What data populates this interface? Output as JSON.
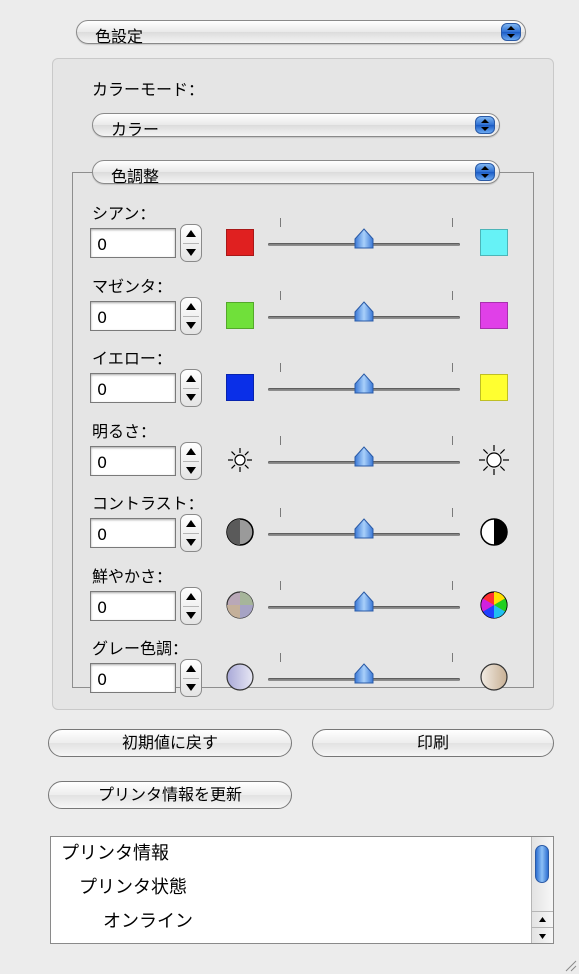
{
  "top_popup": {
    "value": "色設定"
  },
  "color_mode": {
    "label": "カラーモード：",
    "popup_value": "カラー"
  },
  "adjust_popup": {
    "value": "色調整"
  },
  "adjustments": [
    {
      "label": "シアン：",
      "value": "0",
      "left_icon": "red-swatch",
      "right_icon": "cyan-swatch",
      "left_color": "#e02020",
      "right_color": "#66f2f6"
    },
    {
      "label": "マゼンタ：",
      "value": "0",
      "left_icon": "green-swatch",
      "right_icon": "magenta-swatch",
      "left_color": "#70e03a",
      "right_color": "#e040e8"
    },
    {
      "label": "イエロー：",
      "value": "0",
      "left_icon": "blue-swatch",
      "right_icon": "yellow-swatch",
      "left_color": "#0a2fe8",
      "right_color": "#ffff30"
    },
    {
      "label": "明るさ：",
      "value": "0",
      "left_icon": "dim-sun-icon",
      "right_icon": "bright-sun-icon"
    },
    {
      "label": "コントラスト：",
      "value": "0",
      "left_icon": "low-contrast-icon",
      "right_icon": "high-contrast-icon"
    },
    {
      "label": "鮮やかさ：",
      "value": "0",
      "left_icon": "dull-color-wheel-icon",
      "right_icon": "vivid-color-wheel-icon"
    },
    {
      "label": "グレー色調：",
      "value": "0",
      "left_icon": "cool-gray-icon",
      "right_icon": "warm-gray-icon"
    }
  ],
  "buttons": {
    "reset": "初期値に戻す",
    "print": "印刷",
    "update_printer_info": "プリンタ情報を更新"
  },
  "info_list": [
    "プリンタ情報",
    "プリンタ状態",
    "オンライン"
  ]
}
